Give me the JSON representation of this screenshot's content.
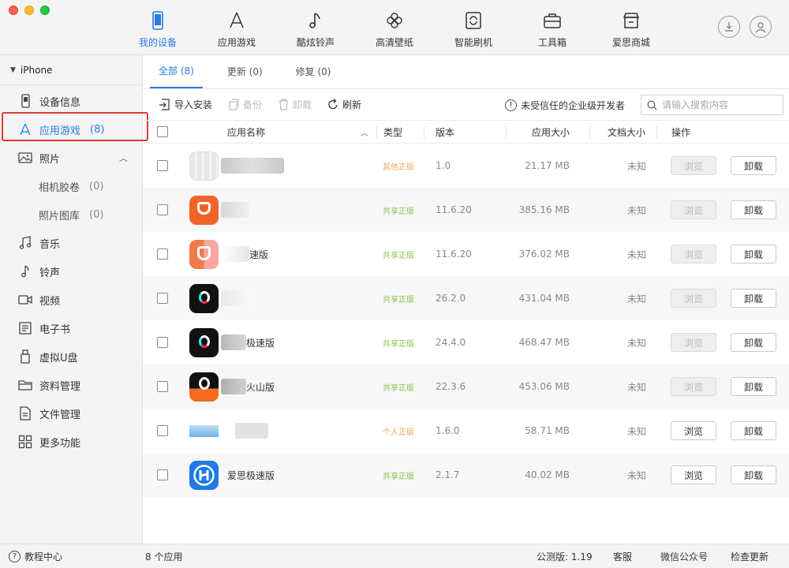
{
  "nav": [
    {
      "label": "我的设备",
      "icon": "phone-icon",
      "active": true
    },
    {
      "label": "应用游戏",
      "icon": "appstore-icon"
    },
    {
      "label": "酷炫铃声",
      "icon": "music-note-icon"
    },
    {
      "label": "高清壁纸",
      "icon": "flower-icon"
    },
    {
      "label": "智能刷机",
      "icon": "refresh-box-icon"
    },
    {
      "label": "工具箱",
      "icon": "toolbox-icon"
    },
    {
      "label": "爱思商城",
      "icon": "store-icon"
    }
  ],
  "sidebar": {
    "device": "iPhone",
    "items": [
      {
        "label": "设备信息",
        "icon": "device-info-icon"
      },
      {
        "label": "应用游戏",
        "count": "(8)",
        "icon": "appstore-icon",
        "active": true
      },
      {
        "label": "照片",
        "icon": "photo-icon",
        "caret": "^"
      },
      {
        "label": "相机胶卷",
        "count": "(0)",
        "sub": true
      },
      {
        "label": "照片图库",
        "count": "(0)",
        "sub": true
      },
      {
        "label": "音乐",
        "icon": "music-icon"
      },
      {
        "label": "铃声",
        "icon": "ringtone-icon"
      },
      {
        "label": "视频",
        "icon": "video-icon"
      },
      {
        "label": "电子书",
        "icon": "book-icon"
      },
      {
        "label": "虚拟U盘",
        "icon": "usb-icon"
      },
      {
        "label": "资料管理",
        "icon": "folder-icon"
      },
      {
        "label": "文件管理",
        "icon": "file-icon"
      },
      {
        "label": "更多功能",
        "icon": "grid-icon"
      }
    ]
  },
  "tabs": [
    "全部 (8)",
    "更新 (0)",
    "修复 (0)"
  ],
  "toolbar": {
    "import": "导入安装",
    "backup": "备份",
    "uninstall": "卸载",
    "refresh": "刷新",
    "trust": "未受信任的企业级开发者",
    "search_placeholder": "请输入搜索内容"
  },
  "table": {
    "headers": {
      "name": "应用名称",
      "type": "类型",
      "version": "版本",
      "app_size": "应用大小",
      "doc_size": "文档大小",
      "action": "操作"
    },
    "rows": [
      {
        "name": "",
        "type": "其他正版",
        "type_color": "or",
        "version": "1.0",
        "app_size": "21.17 MB",
        "doc_size": "未知",
        "browse": "浏览",
        "browse_disabled": true,
        "uninstall": "卸载"
      },
      {
        "name": "",
        "type": "共享正版",
        "type_color": "gr",
        "version": "11.6.20",
        "app_size": "385.16 MB",
        "doc_size": "未知",
        "browse": "浏览",
        "browse_disabled": true,
        "uninstall": "卸载"
      },
      {
        "name": "速版",
        "type": "共享正版",
        "type_color": "gr",
        "version": "11.6.20",
        "app_size": "376.02 MB",
        "doc_size": "未知",
        "browse": "浏览",
        "browse_disabled": true,
        "uninstall": "卸载"
      },
      {
        "name": "",
        "type": "共享正版",
        "type_color": "gr",
        "version": "26.2.0",
        "app_size": "431.04 MB",
        "doc_size": "未知",
        "browse": "浏览",
        "browse_disabled": true,
        "uninstall": "卸载"
      },
      {
        "name": "极速版",
        "type": "共享正版",
        "type_color": "gr",
        "version": "24.4.0",
        "app_size": "468.47 MB",
        "doc_size": "未知",
        "browse": "浏览",
        "browse_disabled": true,
        "uninstall": "卸载"
      },
      {
        "name": "火山版",
        "type": "共享正版",
        "type_color": "gr",
        "version": "22.3.6",
        "app_size": "453.06 MB",
        "doc_size": "未知",
        "browse": "浏览",
        "browse_disabled": true,
        "uninstall": "卸载"
      },
      {
        "name": "",
        "type": "个人正版",
        "type_color": "or",
        "version": "1.6.0",
        "app_size": "58.71 MB",
        "doc_size": "未知",
        "browse": "浏览",
        "browse_disabled": false,
        "uninstall": "卸载"
      },
      {
        "name": "爱思极速版",
        "type": "共享正版",
        "type_color": "gr",
        "version": "2.1.7",
        "app_size": "40.02 MB",
        "doc_size": "未知",
        "browse": "浏览",
        "browse_disabled": false,
        "uninstall": "卸载"
      }
    ]
  },
  "statusbar": {
    "help": "教程中心",
    "count": "8 个应用",
    "version": "公测版: 1.19",
    "service": "客服",
    "wechat": "微信公众号",
    "update": "检查更新"
  },
  "colors": {
    "accent": "#2a7ae2",
    "highlight": "#e03c31"
  }
}
